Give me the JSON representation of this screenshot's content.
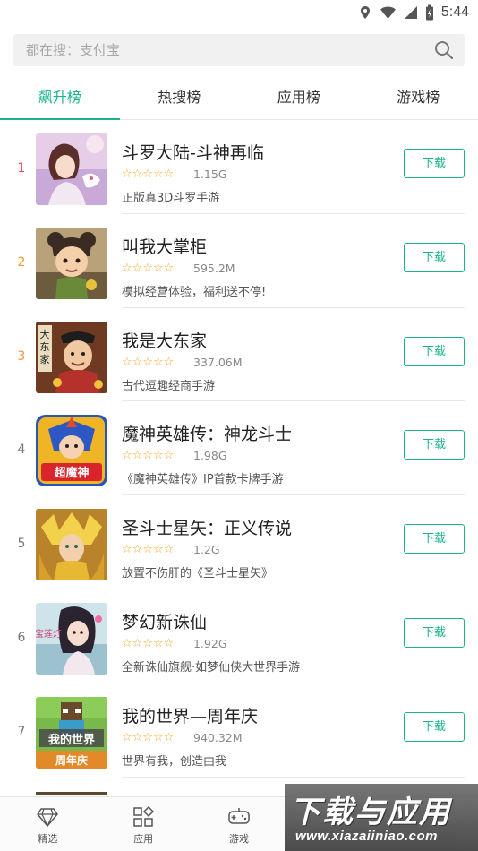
{
  "status_bar": {
    "time": "5:44",
    "icons": [
      "location-icon",
      "wifi-icon",
      "signal-icon",
      "battery-icon"
    ]
  },
  "search": {
    "placeholder": "都在搜：支付宝",
    "icon": "search-icon"
  },
  "tabs": [
    {
      "label": "飙升榜",
      "active": true
    },
    {
      "label": "热搜榜",
      "active": false
    },
    {
      "label": "应用榜",
      "active": false
    },
    {
      "label": "游戏榜",
      "active": false
    }
  ],
  "apps": [
    {
      "rank": "1",
      "name": "斗罗大陆-斗神再临",
      "size": "1.15G",
      "desc": "正版真3D斗罗手游",
      "button": "下载",
      "stars": "☆☆☆☆☆"
    },
    {
      "rank": "2",
      "name": "叫我大掌柜",
      "size": "595.2M",
      "desc": "模拟经营体验，福利送不停!",
      "button": "下载",
      "stars": "☆☆☆☆☆"
    },
    {
      "rank": "3",
      "name": "我是大东家",
      "size": "337.06M",
      "desc": "古代逗趣经商手游",
      "button": "下载",
      "stars": "☆☆☆☆☆"
    },
    {
      "rank": "4",
      "name": "魔神英雄传：神龙斗士",
      "size": "1.98G",
      "desc": "《魔神英雄传》IP首款卡牌手游",
      "button": "下载",
      "stars": "☆☆☆☆☆"
    },
    {
      "rank": "5",
      "name": "圣斗士星矢：正义传说",
      "size": "1.2G",
      "desc": "放置不伤肝的《圣斗士星矢》",
      "button": "下载",
      "stars": "☆☆☆☆☆"
    },
    {
      "rank": "6",
      "name": "梦幻新诛仙",
      "size": "1.92G",
      "desc": "全新诛仙旗舰·如梦仙侠大世界手游",
      "button": "下载",
      "stars": "☆☆☆☆☆"
    },
    {
      "rank": "7",
      "name": "我的世界—周年庆",
      "size": "940.32M",
      "desc": "世界有我，创造由我",
      "button": "下载",
      "stars": "☆☆☆☆☆"
    }
  ],
  "icon_art": {
    "rank4_text": "超魔神",
    "rank6_text": "宝莲灯",
    "rank7_text": "我的世界",
    "rank7_sub": "周年庆"
  },
  "bottom_nav": [
    {
      "label": "精选",
      "icon": "diamond-icon"
    },
    {
      "label": "应用",
      "icon": "apps-grid-icon"
    },
    {
      "label": "游戏",
      "icon": "gamepad-icon"
    },
    {
      "label": "",
      "icon": "hidden"
    },
    {
      "label": "",
      "icon": "hidden"
    }
  ],
  "watermark": {
    "title": "下载与应用",
    "url": "www.xiazaiiniao.com"
  },
  "colors": {
    "accent": "#1cb48e",
    "rank_top": "#e8454b",
    "rank_mid": "#f39a2c",
    "star": "#f5a623"
  }
}
